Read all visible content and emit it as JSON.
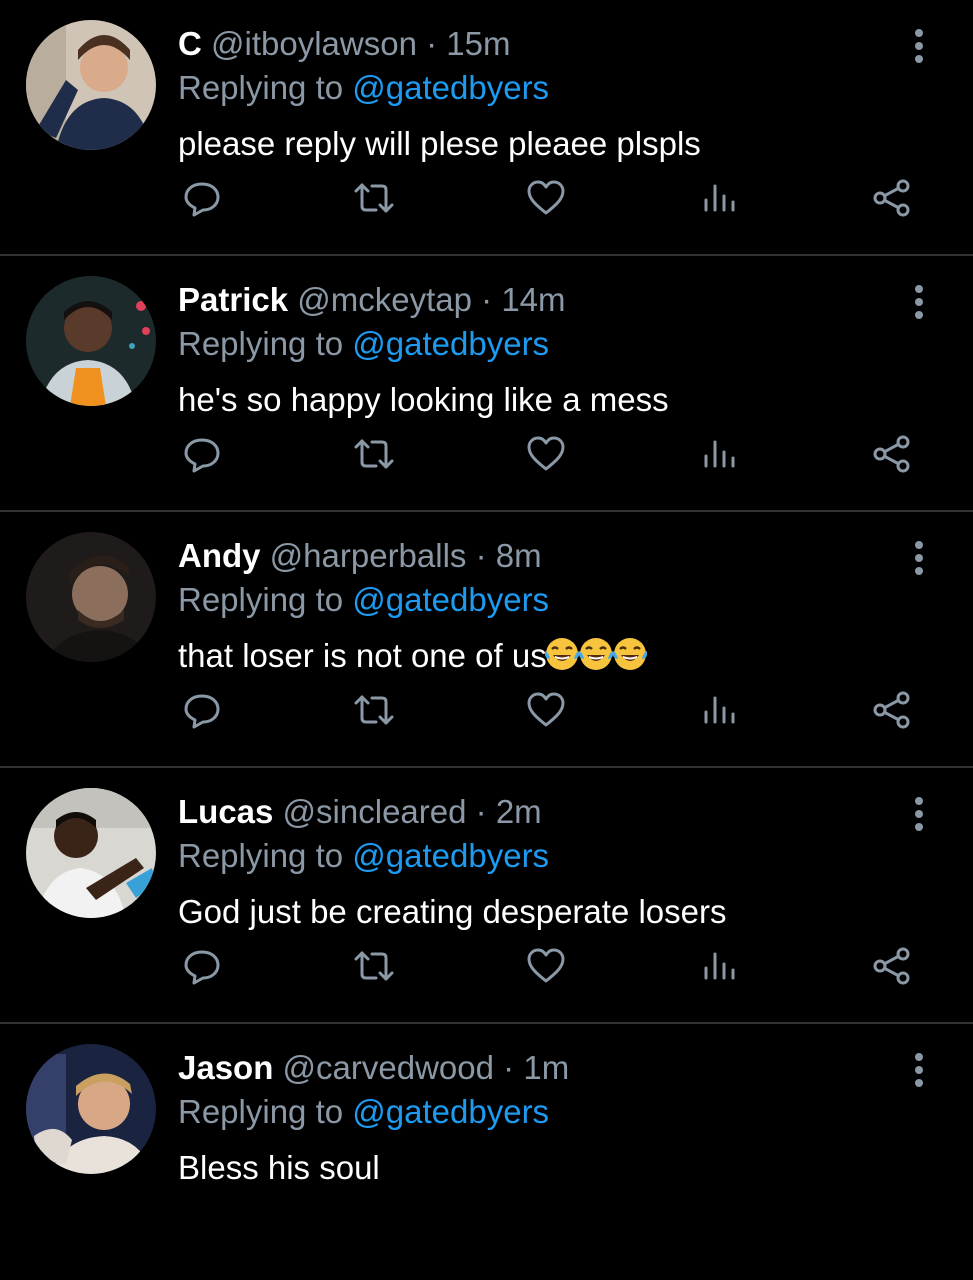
{
  "reply_label": "Replying to",
  "tweets": [
    {
      "name": "C",
      "handle": "@itboylawson",
      "time": "15m",
      "replying_to": "@gatedbyers",
      "text": "please reply will plese pleaee plspls",
      "avatar_color": "#cfc4b6"
    },
    {
      "name": "Patrick",
      "handle": "@mckeytap",
      "time": "14m",
      "replying_to": "@gatedbyers",
      "text": "he's so happy looking like a mess",
      "avatar_color": "#1c2a2c"
    },
    {
      "name": "Andy",
      "handle": "@harperballs",
      "time": "8m",
      "replying_to": "@gatedbyers",
      "text": "that loser is not one of us",
      "emoji_count": 3,
      "emoji": "face-with-tears-of-joy",
      "avatar_color": "#1e1b1a"
    },
    {
      "name": "Lucas",
      "handle": "@sincleared",
      "time": "2m",
      "replying_to": "@gatedbyers",
      "text": "God just be creating desperate losers",
      "avatar_color": "#d9d7d2"
    },
    {
      "name": "Jason",
      "handle": "@carvedwood",
      "time": "1m",
      "replying_to": "@gatedbyers",
      "text": "Bless his soul",
      "avatar_color": "#1a2340"
    }
  ],
  "icons": [
    "reply-icon",
    "retweet-icon",
    "like-icon",
    "analytics-icon",
    "share-icon",
    "more-icon"
  ],
  "colors": {
    "background": "#000000",
    "text": "#ffffff",
    "muted": "#8b98a5",
    "link": "#1d9bf0",
    "divider": "#2f3336"
  }
}
